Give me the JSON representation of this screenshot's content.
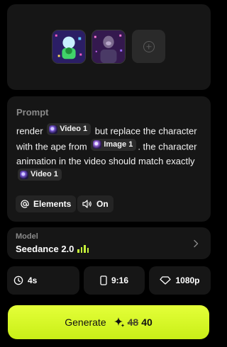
{
  "media": {
    "items": [
      {
        "icon": "reference-video-thumbnail"
      },
      {
        "icon": "reference-image-thumbnail"
      }
    ],
    "add_icon": "plus-circle-icon"
  },
  "prompt": {
    "label": "Prompt",
    "segments": {
      "t1": "render",
      "chip1": "Video 1",
      "t2": "but replace the character with the ape from",
      "chip2": "Image 1",
      "t3": ". the character animation in the video should match exactly",
      "chip3": "Video 1"
    },
    "elements_label": "Elements",
    "audio_label": "On"
  },
  "model": {
    "label": "Model",
    "name": "Seedance 2.0"
  },
  "options": {
    "duration": "4s",
    "aspect_ratio": "9:16",
    "resolution": "1080p"
  },
  "generate": {
    "label": "Generate",
    "old_cost": "48",
    "new_cost": "40"
  },
  "colors": {
    "accent": "#c6f43a",
    "card_bg": "#161616",
    "page_bg": "#000000"
  }
}
